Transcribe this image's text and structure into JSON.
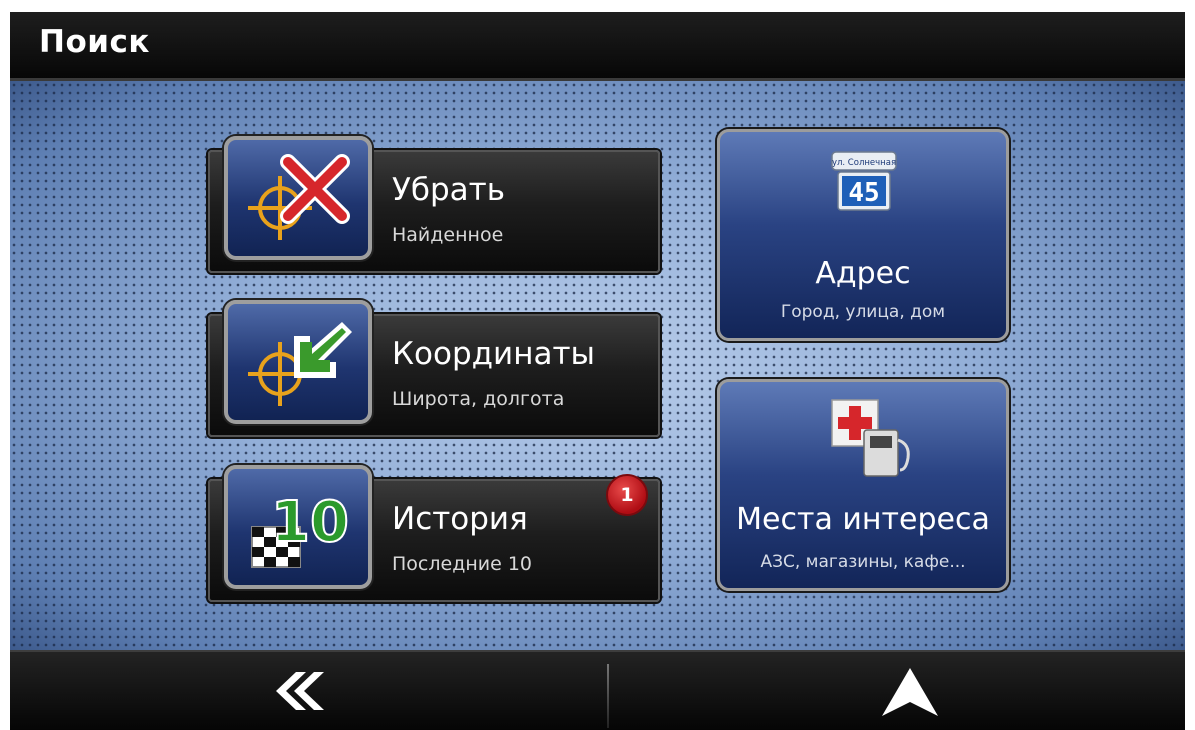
{
  "header": {
    "title": "Поиск"
  },
  "menu": {
    "remove": {
      "label": "Убрать",
      "sublabel": "Найденное",
      "icon": "remove-target-icon"
    },
    "coordinates": {
      "label": "Координаты",
      "sublabel": "Широта, долгота",
      "icon": "coordinates-icon"
    },
    "history": {
      "label": "История",
      "sublabel": "Последние 10",
      "icon": "history-icon",
      "badge": "1"
    },
    "address": {
      "label": "Адрес",
      "sublabel": "Город, улица, дом",
      "icon": "street-sign-icon",
      "sign_street": "ул. Солнечная",
      "sign_number": "45"
    },
    "poi": {
      "label": "Места интереса",
      "sublabel": "АЗС, магазины, кафе...",
      "icon": "poi-icon"
    }
  },
  "history_icon_number": "10",
  "footer": {
    "back_icon": "double-chevron-left-icon",
    "navigate_icon": "navigation-arrow-icon"
  },
  "colors": {
    "accent_blue": "#1f3570",
    "badge_red": "#c0141b",
    "background_blue": "#93afd8"
  }
}
